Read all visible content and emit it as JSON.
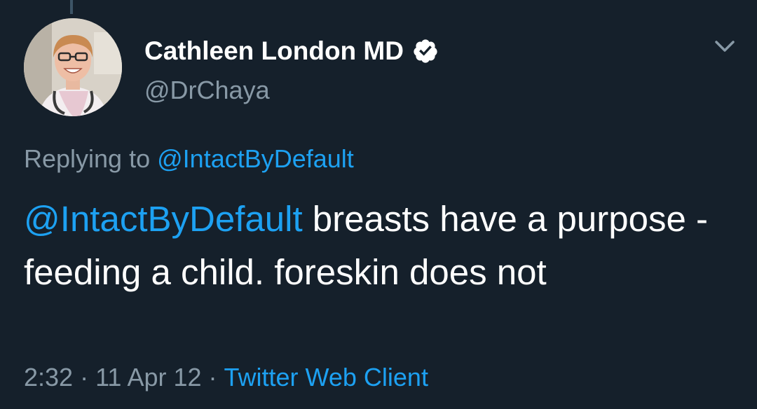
{
  "author": {
    "display_name": "Cathleen London MD",
    "handle": "@DrChaya",
    "verified": true
  },
  "reply": {
    "prefix": "Replying to",
    "mention": "@IntactByDefault"
  },
  "tweet": {
    "mention": "@IntactByDefault",
    "text": "breasts have a purpose - feeding a child. foreskin does not"
  },
  "meta": {
    "time": "2:32",
    "separator": "·",
    "date": "11 Apr 12",
    "client": "Twitter Web Client"
  },
  "icons": {
    "verified": "verified-badge-icon",
    "menu": "chevron-down-icon"
  },
  "colors": {
    "background": "#15202b",
    "link": "#1da1f2",
    "secondary_text": "#8899a6",
    "primary_text": "#ffffff"
  }
}
